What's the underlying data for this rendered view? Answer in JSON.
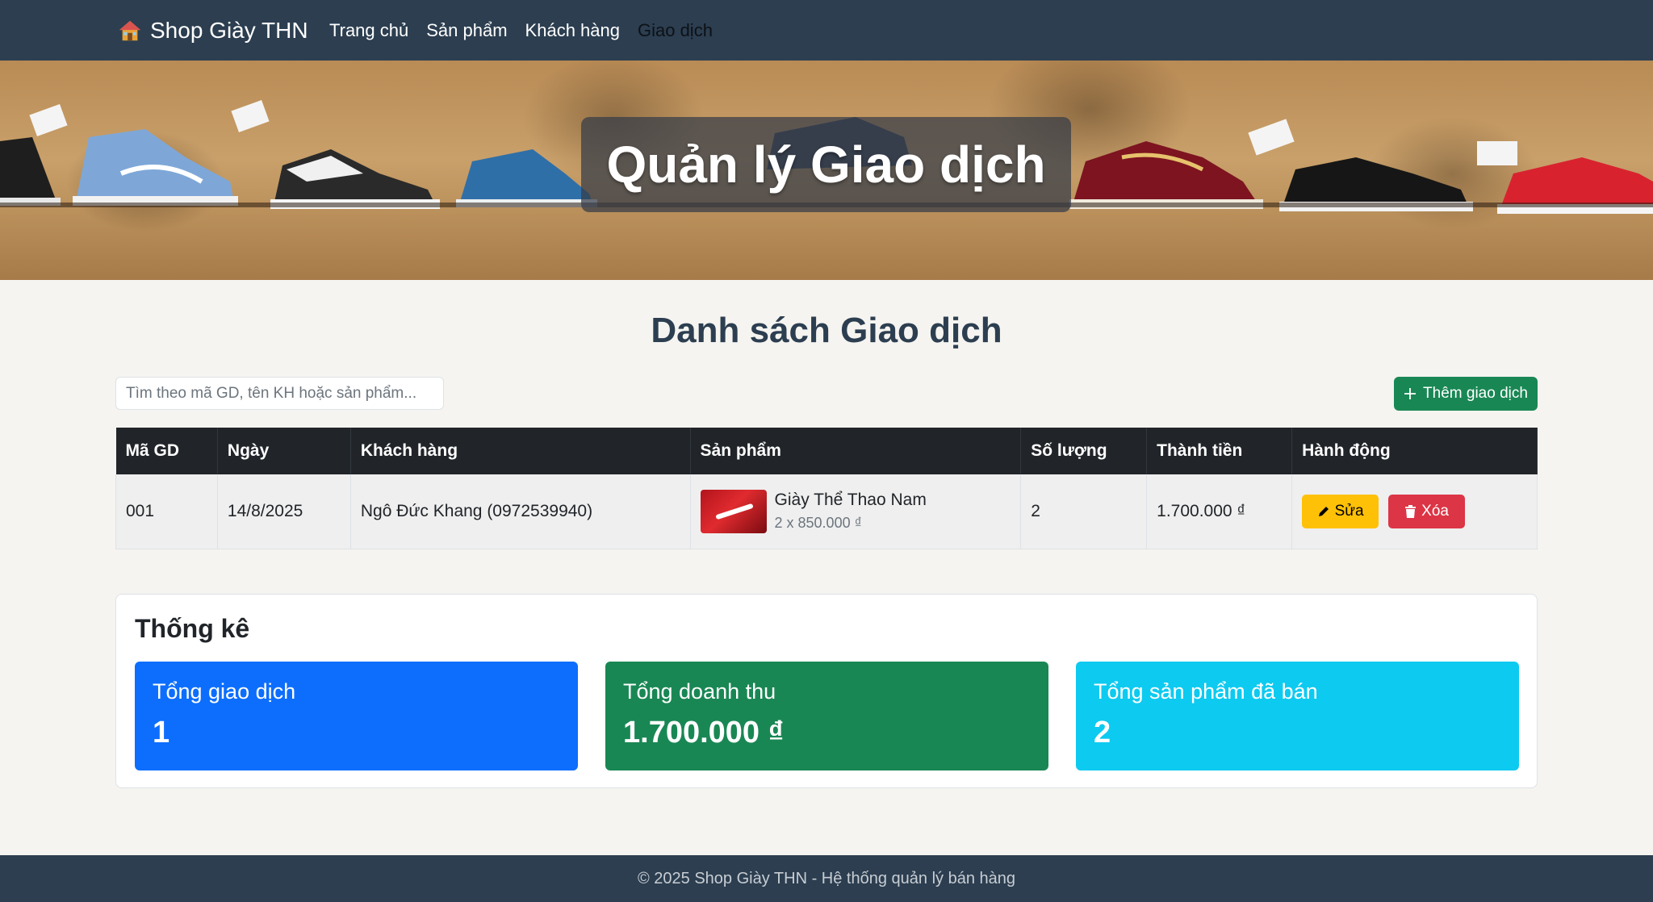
{
  "navbar": {
    "brand": "Shop Giày THN",
    "links": [
      "Trang chủ",
      "Sản phẩm",
      "Khách hàng",
      "Giao dịch"
    ],
    "active_link": "Giao dịch"
  },
  "hero": {
    "title": "Quản lý Giao dịch"
  },
  "main": {
    "title": "Danh sách Giao dịch",
    "search_placeholder": "Tìm theo mã GD, tên KH hoặc sản phẩm...",
    "add_button": "Thêm giao dịch"
  },
  "table": {
    "headers": [
      "Mã GD",
      "Ngày",
      "Khách hàng",
      "Sản phẩm",
      "Số lượng",
      "Thành tiền",
      "Hành động"
    ],
    "rows": [
      {
        "id": "001",
        "date": "14/8/2025",
        "customer": "Ngô Đức Khang (0972539940)",
        "product_name": "Giày Thể Thao Nam",
        "product_detail": "2 x 850.000 ₫",
        "quantity": "2",
        "total": "1.700.000 ₫",
        "edit_label": "Sửa",
        "delete_label": "Xóa"
      }
    ]
  },
  "stats": {
    "title": "Thống kê",
    "items": [
      {
        "label": "Tổng giao dịch",
        "value": "1",
        "color": "#0d6efd"
      },
      {
        "label": "Tổng doanh thu",
        "value": "1.700.000 ₫",
        "color": "#198754"
      },
      {
        "label": "Tổng sản phẩm đã bán",
        "value": "2",
        "color": "#0dcaf0"
      }
    ]
  },
  "footer": {
    "text": "© 2025 Shop Giày THN - Hệ thống quản lý bán hàng"
  },
  "colors": {
    "navbar": "#2c3e50",
    "success": "#198754",
    "warning": "#ffc107",
    "danger": "#dc3545"
  },
  "icons": {
    "brand": "house-icon",
    "add": "plus-icon",
    "edit": "pencil-icon",
    "delete": "trash-icon"
  }
}
